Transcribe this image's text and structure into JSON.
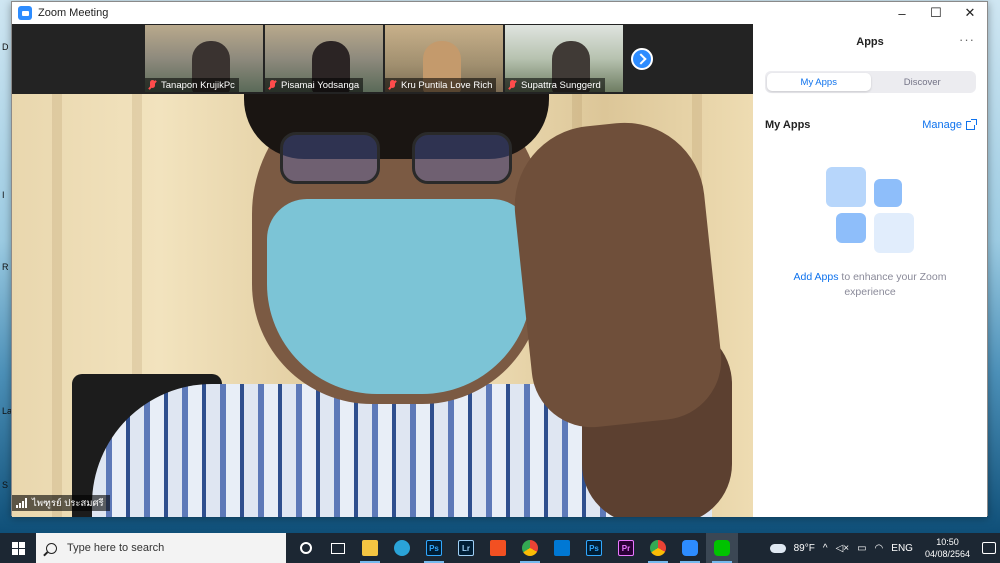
{
  "window": {
    "title": "Zoom Meeting",
    "controls": [
      "–",
      "☐",
      "✕"
    ]
  },
  "desktop_labels": [
    "D",
    "I",
    "R",
    "La",
    "S"
  ],
  "participants": [
    {
      "name": "Tanapon KrujikPc",
      "muted": true
    },
    {
      "name": "Pisamai Yodsanga",
      "muted": true
    },
    {
      "name": "Kru Puntila Love Rich",
      "muted": true
    },
    {
      "name": "Supattra Sunggerd",
      "muted": true
    }
  ],
  "active_speaker": {
    "name": "ไพฑูรย์ ประสมศรี"
  },
  "apps_panel": {
    "title": "Apps",
    "more": "···",
    "tabs": [
      {
        "label": "My Apps",
        "active": true
      },
      {
        "label": "Discover",
        "active": false
      }
    ],
    "section_title": "My Apps",
    "manage_label": "Manage",
    "empty_link": "Add Apps",
    "empty_text": " to enhance your Zoom experience"
  },
  "taskbar": {
    "search_placeholder": "Type here to search",
    "apps": [
      {
        "name": "cortana",
        "label": ""
      },
      {
        "name": "task-view",
        "label": ""
      },
      {
        "name": "file-explorer",
        "label": ""
      },
      {
        "name": "edge",
        "label": ""
      },
      {
        "name": "photoshop",
        "label": "Ps"
      },
      {
        "name": "lightroom",
        "label": "Lr"
      },
      {
        "name": "store",
        "label": ""
      },
      {
        "name": "chrome",
        "label": ""
      },
      {
        "name": "mail",
        "label": ""
      },
      {
        "name": "photoshop-2",
        "label": "Ps"
      },
      {
        "name": "premiere",
        "label": "Pr"
      },
      {
        "name": "chrome-2",
        "label": ""
      },
      {
        "name": "zoom",
        "label": ""
      },
      {
        "name": "line",
        "label": ""
      }
    ],
    "weather": "89°F",
    "language": "ENG",
    "time": "10:50",
    "date": "04/08/2564"
  }
}
